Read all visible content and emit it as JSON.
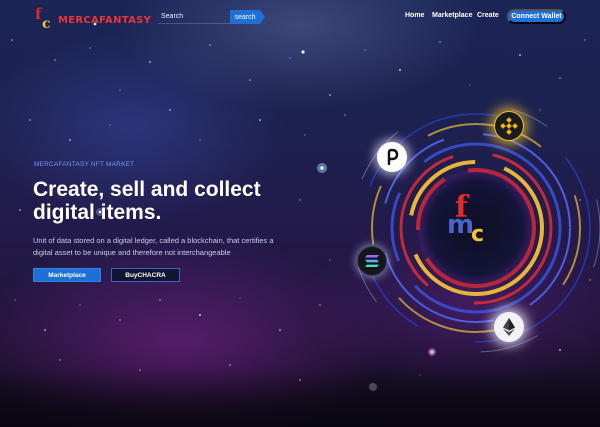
{
  "brand": {
    "name": "MERCAFANTASY",
    "mark_f": "f",
    "mark_c": "c"
  },
  "search": {
    "placeholder": "Search",
    "button_label": "search"
  },
  "nav": {
    "home": "Home",
    "marketplace": "Marketplace",
    "create": "Create"
  },
  "connect_label": "Connect Wallet",
  "hero": {
    "eyebrow": "MERCAFANTASY NFT MARKET",
    "title": "Create, sell and collect digital items.",
    "description": "Unit of data stored on a digital ledger, called a blockchain, that certifies a digital asset to be unique and therefore not interchangeable",
    "primary_button": "Marketplace",
    "secondary_button": "BuyCHACRA"
  },
  "center_logo": {
    "f": "f",
    "m": "m",
    "c": "c"
  },
  "coins": [
    "binance-coin-icon",
    "polkadot-coin-icon",
    "solana-coin-icon",
    "ethereum-coin-icon"
  ],
  "colors": {
    "accent": "#1e6fd6",
    "brand_red": "#e02a2a",
    "brand_gold": "#f2c230",
    "eyebrow": "#6f98ff"
  }
}
